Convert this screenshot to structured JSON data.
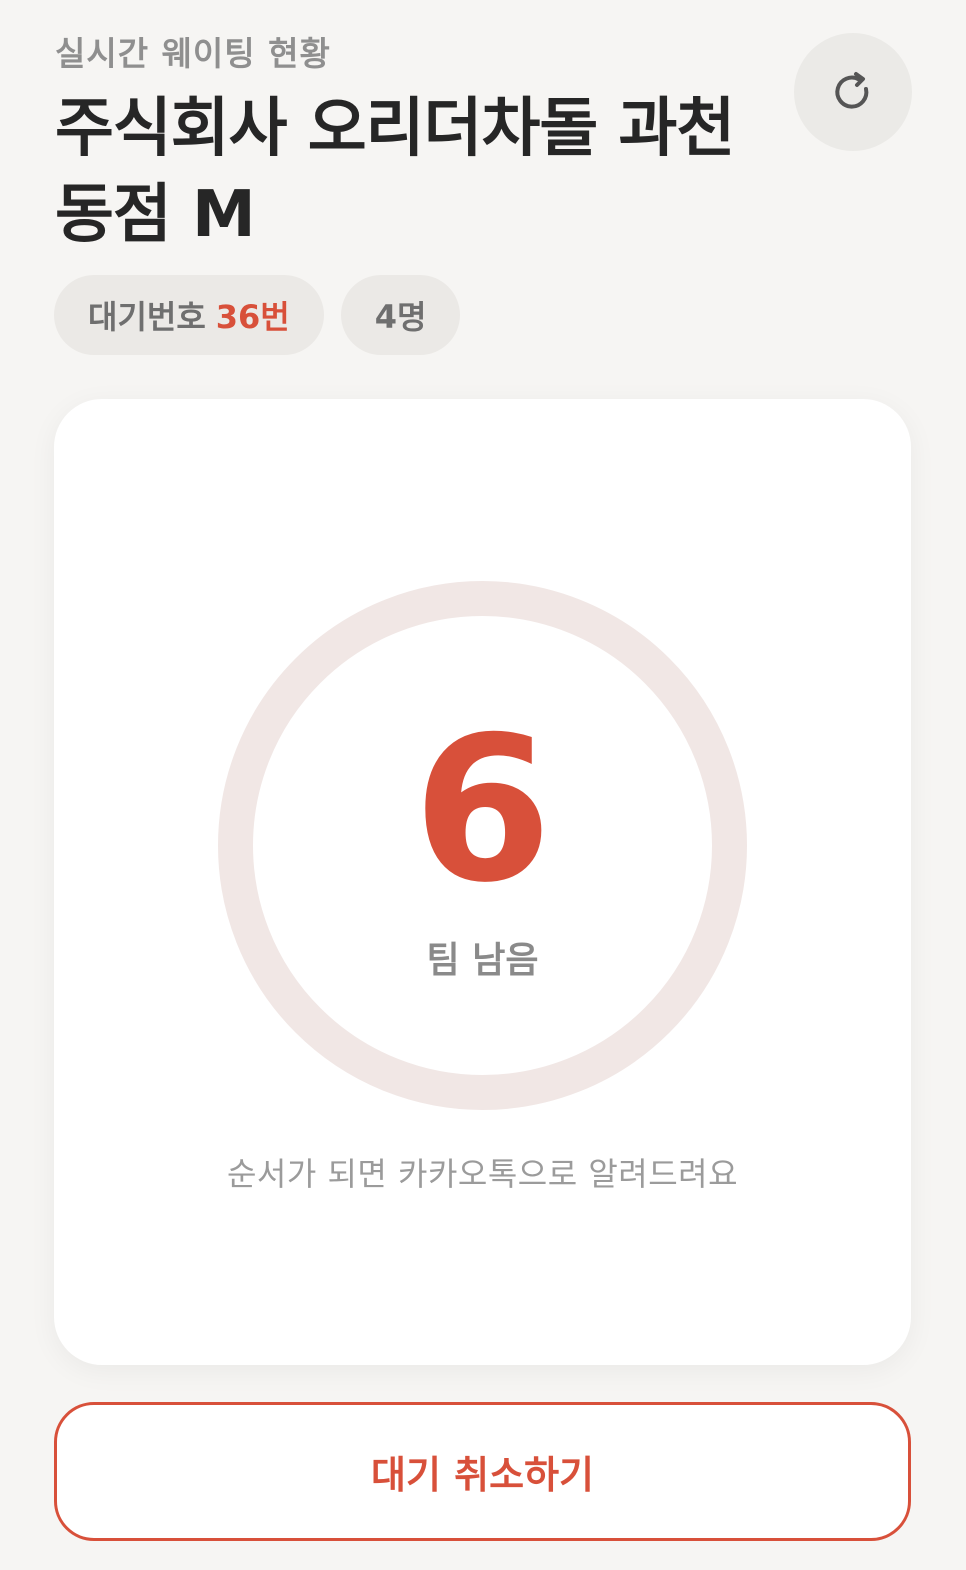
{
  "header": {
    "subtitle": "실시간 웨이팅 현황",
    "title": "주식회사 오리더차돌 과천동점 M"
  },
  "refresh": {
    "icon": "refresh-icon"
  },
  "chips": {
    "queue_label": "대기번호",
    "queue_number": "36번",
    "party_size": "4명"
  },
  "status": {
    "teams_remaining": "6",
    "teams_remaining_label": "팀 남음",
    "notice": "순서가 되면 카카오톡으로 알려드려요"
  },
  "actions": {
    "cancel_label": "대기 취소하기"
  },
  "colors": {
    "accent": "#d8503a",
    "ring_track": "#f1e7e5",
    "background": "#f6f5f3"
  }
}
